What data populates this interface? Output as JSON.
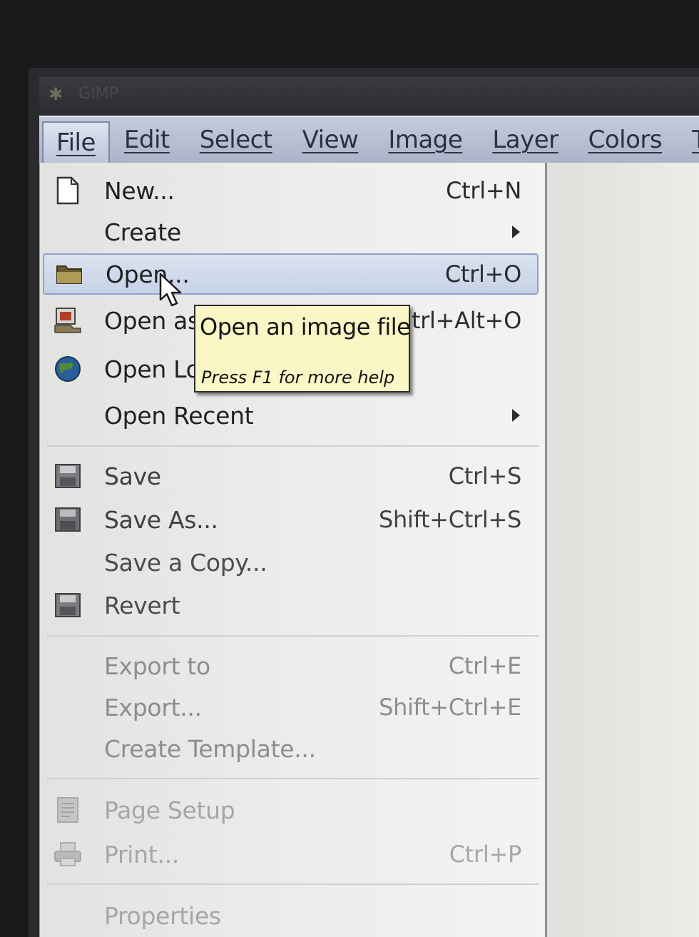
{
  "window": {
    "title": "GIMP"
  },
  "menubar": {
    "items": [
      "File",
      "Edit",
      "Select",
      "View",
      "Image",
      "Layer",
      "Colors",
      "Too"
    ]
  },
  "file_menu": {
    "new": {
      "label": "New...",
      "shortcut": "Ctrl+N",
      "icon": "new-document-icon"
    },
    "create": {
      "label": "Create",
      "icon": "submenu-arrow-icon"
    },
    "open": {
      "label": "Open...",
      "shortcut": "Ctrl+O",
      "icon": "folder-icon"
    },
    "open_as_layers": {
      "label": "Open as",
      "shortcut": "trl+Alt+O",
      "icon": "open-as-layers-icon"
    },
    "open_location": {
      "label": "Open Lo",
      "icon": "globe-icon"
    },
    "open_recent": {
      "label": "Open Recent",
      "icon": "submenu-arrow-icon"
    },
    "save": {
      "label": "Save",
      "shortcut": "Ctrl+S",
      "icon": "save-icon"
    },
    "save_as": {
      "label": "Save As...",
      "shortcut": "Shift+Ctrl+S",
      "icon": "save-as-icon"
    },
    "save_copy": {
      "label": "Save a Copy..."
    },
    "revert": {
      "label": "Revert",
      "icon": "revert-icon"
    },
    "export_to": {
      "label": "Export to",
      "shortcut": "Ctrl+E"
    },
    "export": {
      "label": "Export...",
      "shortcut": "Shift+Ctrl+E"
    },
    "create_template": {
      "label": "Create Template..."
    },
    "page_setup": {
      "label": "Page Setup",
      "icon": "page-setup-icon"
    },
    "print": {
      "label": "Print...",
      "shortcut": "Ctrl+P",
      "icon": "printer-icon"
    },
    "properties": {
      "label": "Properties"
    }
  },
  "tooltip": {
    "title": "Open an image file",
    "help": "Press F1 for more help"
  },
  "colors": {
    "menubar": "#aab3c9",
    "highlight": "#c6d2e6",
    "tooltip": "#fbf6c6"
  }
}
